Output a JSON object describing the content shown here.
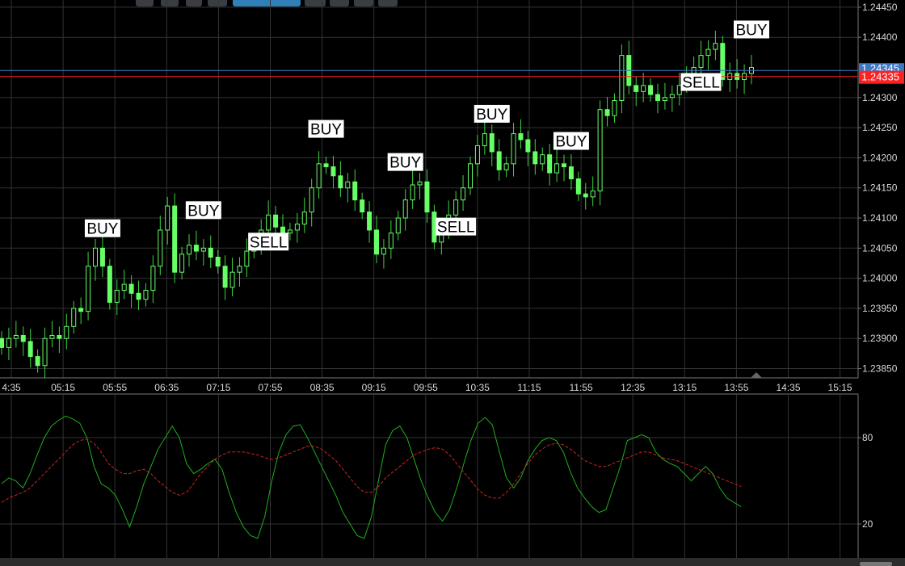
{
  "toolbar": {
    "icons": [
      "zoom-icon",
      "settings-sliders-icon",
      "anchor-icon",
      "indicators-icon",
      "primary-action",
      "list-icon",
      "drawing-icon",
      "cloud-icon",
      "triangle-icon"
    ]
  },
  "colors": {
    "background": "#000000",
    "grid": "#333333",
    "bullish": "#66ff66",
    "wick": "#3fd43f",
    "stoch_k": "#1fae1f",
    "stoch_d": "#cc2222",
    "price_line_red": "#ff2020",
    "price_line_blue": "#3b78c6"
  },
  "chart_data": [
    {
      "type": "candlestick",
      "ylim": [
        1.2383,
        1.2445
      ],
      "y_ticks": [
        "1.24450",
        "1.24400",
        "1.24300",
        "1.24250",
        "1.24200",
        "1.24150",
        "1.24100",
        "1.24050",
        "1.24000",
        "1.23950",
        "1.23900",
        "1.23850"
      ],
      "y_tick_values": [
        1.2445,
        1.244,
        1.243,
        1.2425,
        1.242,
        1.2415,
        1.241,
        1.2405,
        1.24,
        1.2395,
        1.239,
        1.2385
      ],
      "x_ticks": [
        "4:35",
        "05:15",
        "05:55",
        "06:35",
        "07:15",
        "07:55",
        "08:35",
        "09:15",
        "09:55",
        "10:35",
        "11:15",
        "11:55",
        "12:35",
        "13:15",
        "13:55",
        "14:35",
        "15:15"
      ],
      "current_price": {
        "value": 1.24335,
        "label": "1.24335"
      },
      "ask_price": {
        "value": 1.24345,
        "label": "1.24345"
      },
      "closes": [
        1.23885,
        1.239,
        1.23905,
        1.23895,
        1.2387,
        1.23855,
        1.239,
        1.23905,
        1.239,
        1.2392,
        1.2395,
        1.23945,
        1.2402,
        1.2405,
        1.2402,
        1.2396,
        1.2398,
        1.2399,
        1.23975,
        1.23965,
        1.2398,
        1.2402,
        1.2408,
        1.2412,
        1.2401,
        1.2404,
        1.24055,
        1.24045,
        1.2405,
        1.24035,
        1.2402,
        1.23985,
        1.2401,
        1.2402,
        1.24045,
        1.2406,
        1.2408,
        1.24105,
        1.24085,
        1.24075,
        1.2408,
        1.2409,
        1.2411,
        1.2415,
        1.2419,
        1.24185,
        1.2417,
        1.2415,
        1.2416,
        1.2413,
        1.2411,
        1.2408,
        1.2404,
        1.2405,
        1.24075,
        1.241,
        1.2413,
        1.24155,
        1.2416,
        1.2411,
        1.2406,
        1.2408,
        1.24105,
        1.2413,
        1.2415,
        1.2419,
        1.2422,
        1.2424,
        1.2421,
        1.2418,
        1.2419,
        1.2424,
        1.2423,
        1.2421,
        1.2419,
        1.24205,
        1.24175,
        1.2419,
        1.24185,
        1.24165,
        1.2414,
        1.24135,
        1.24145,
        1.2428,
        1.2427,
        1.24295,
        1.2437,
        1.2432,
        1.2431,
        1.2432,
        1.24305,
        1.24295,
        1.243,
        1.24305,
        1.2432,
        1.2434,
        1.2435,
        1.2437,
        1.2438,
        1.2439,
        1.2433,
        1.2434,
        1.2433,
        1.2434,
        1.2435
      ],
      "series": [
        {
          "name": "",
          "values": []
        }
      ],
      "signals": [
        {
          "label": "BUY",
          "index": 14
        },
        {
          "label": "BUY",
          "index": 28
        },
        {
          "label": "SELL",
          "index": 37
        },
        {
          "label": "BUY",
          "index": 45
        },
        {
          "label": "BUY",
          "index": 56
        },
        {
          "label": "SELL",
          "index": 63
        },
        {
          "label": "BUY",
          "index": 68
        },
        {
          "label": "BUY",
          "index": 79
        },
        {
          "label": "SELL",
          "index": 97
        },
        {
          "label": "BUY",
          "index": 104
        }
      ]
    },
    {
      "type": "line",
      "ylim": [
        0,
        100
      ],
      "y_ticks": [
        "80",
        "20"
      ],
      "y_tick_values": [
        80,
        20
      ],
      "series": [
        {
          "name": "",
          "role": "k",
          "values": [
            48,
            52,
            50,
            45,
            55,
            68,
            80,
            88,
            92,
            95,
            93,
            90,
            80,
            60,
            48,
            45,
            40,
            30,
            18,
            32,
            48,
            60,
            72,
            80,
            88,
            80,
            62,
            55,
            58,
            62,
            65,
            58,
            42,
            28,
            18,
            12,
            10,
            25,
            50,
            70,
            82,
            88,
            89,
            80,
            70,
            60,
            50,
            40,
            28,
            20,
            12,
            10,
            25,
            50,
            75,
            85,
            88,
            80,
            65,
            50,
            38,
            28,
            22,
            30,
            45,
            62,
            78,
            90,
            94,
            89,
            70,
            52,
            45,
            52,
            64,
            72,
            78,
            80,
            78,
            70,
            56,
            45,
            38,
            32,
            28,
            30,
            45,
            60,
            78,
            80,
            82,
            80,
            70,
            65,
            62,
            60,
            55,
            50,
            55,
            60,
            55,
            45,
            38,
            35,
            32
          ]
        },
        {
          "name": "",
          "role": "d",
          "values": [
            35,
            38,
            40,
            42,
            45,
            50,
            55,
            60,
            65,
            70,
            75,
            78,
            79,
            76,
            70,
            62,
            58,
            55,
            55,
            57,
            58,
            55,
            50,
            46,
            42,
            40,
            42,
            48,
            55,
            60,
            65,
            68,
            70,
            70,
            70,
            69,
            68,
            66,
            65,
            66,
            68,
            70,
            72,
            74,
            74,
            72,
            68,
            64,
            58,
            52,
            46,
            42,
            42,
            46,
            52,
            56,
            60,
            64,
            68,
            70,
            72,
            73,
            72,
            68,
            62,
            56,
            50,
            44,
            40,
            38,
            38,
            42,
            48,
            55,
            62,
            68,
            72,
            75,
            76,
            75,
            72,
            68,
            64,
            62,
            60,
            60,
            62,
            64,
            66,
            68,
            70,
            70,
            68,
            66,
            65,
            64,
            62,
            60,
            58,
            56,
            54,
            52,
            50,
            48,
            46
          ]
        }
      ]
    }
  ]
}
